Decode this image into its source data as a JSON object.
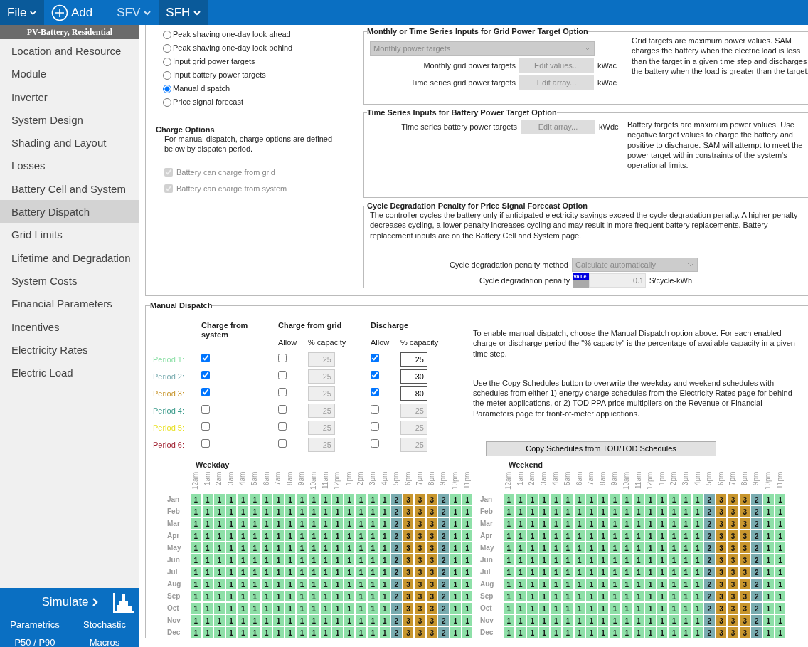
{
  "toolbar": [
    {
      "kind": "file",
      "label": "File"
    },
    {
      "kind": "add",
      "label": "Add"
    },
    {
      "kind": "case",
      "label": "SFV",
      "selected": false
    },
    {
      "kind": "case",
      "label": "SFH",
      "selected": true
    }
  ],
  "sidebar": {
    "title": "PV-Battery, Residential",
    "items": [
      {
        "label": "Location and Resource",
        "selected": false
      },
      {
        "label": "Module",
        "selected": false
      },
      {
        "label": "Inverter",
        "selected": false
      },
      {
        "label": "System Design",
        "selected": false
      },
      {
        "label": "Shading and Layout",
        "selected": false
      },
      {
        "label": "Losses",
        "selected": false
      },
      {
        "label": "Battery Cell and System",
        "selected": false
      },
      {
        "label": "Battery Dispatch",
        "selected": true
      },
      {
        "label": "Grid Limits",
        "selected": false
      },
      {
        "label": "Lifetime and Degradation",
        "selected": false
      },
      {
        "label": "System Costs",
        "selected": false
      },
      {
        "label": "Financial Parameters",
        "selected": false
      },
      {
        "label": "Incentives",
        "selected": false
      },
      {
        "label": "Electricity Rates",
        "selected": false
      },
      {
        "label": "Electric Load",
        "selected": false
      }
    ],
    "simulate": {
      "label": "Simulate",
      "links": [
        "Parametrics",
        "Stochastic",
        "P50 / P90",
        "Macros"
      ]
    }
  },
  "dispatch_options": [
    {
      "label": "Peak shaving one-day look ahead",
      "selected": false
    },
    {
      "label": "Peak shaving one-day look behind",
      "selected": false
    },
    {
      "label": "Input grid power targets",
      "selected": false
    },
    {
      "label": "Input battery power targets",
      "selected": false
    },
    {
      "label": "Manual dispatch",
      "selected": true
    },
    {
      "label": "Price signal forecast",
      "selected": false
    }
  ],
  "charge_options": {
    "title": "Charge Options",
    "note": "For manual dispatch, charge options are defined below by dispatch period.",
    "checkboxes": [
      {
        "label": "Battery can charge from grid",
        "checked": true,
        "disabled": true
      },
      {
        "label": "Battery can charge from system",
        "checked": true,
        "disabled": true
      }
    ]
  },
  "grid_target": {
    "title": "Monthly or Time Series Inputs for Grid Power Target Option",
    "dropdown": {
      "value": "Monthly power targets",
      "disabled": true
    },
    "rows": [
      {
        "label": "Monthly grid power targets",
        "button": "Edit values...",
        "unit": "kWac"
      },
      {
        "label": "Time series grid power targets",
        "button": "Edit array...",
        "unit": "kWac"
      }
    ],
    "note": "Grid targets are maximum power values. SAM charges the battery when the electric load is less than the target in a given time step and discharges the battery when the load is greater than the target."
  },
  "battery_target": {
    "title": "Time Series Inputs for Battery Power Target Option",
    "rows": [
      {
        "label": "Time series battery power targets",
        "button": "Edit array...",
        "unit": "kWdc"
      }
    ],
    "note": "Battery targets are maximum power values. Use negative target values to charge the battery and positive to discharge. SAM will attempt to meet the power target within constraints of the system's operational limits."
  },
  "cycle_penalty": {
    "title": "Cycle Degradation Penalty for Price Signal Forecast Option",
    "note": "The controller cycles the battery only if anticipated electricity savings exceed the cycle degradation penalty. A higher penalty decreases cycling, a lower penalty increases cycling and may result in more frequent battery replacements. Battery replacement inputs are on the  Battery Cell and System page.",
    "method_label": "Cycle degradation penalty method",
    "method_value": "Calculate automatically",
    "penalty_label": "Cycle degradation penalty",
    "penalty_badge": "Value",
    "penalty_value": "0.1",
    "penalty_unit": "$/cycle-kWh"
  },
  "manual_dispatch": {
    "title": "Manual Dispatch",
    "headers": {
      "charge_system": "Charge from system",
      "charge_grid": "Charge from grid",
      "discharge": "Discharge",
      "allow_1": "Allow",
      "capacity_1": "% capacity",
      "allow_2": "Allow",
      "capacity_2": "% capacity"
    },
    "periods": [
      {
        "label": "Period 1:",
        "color": "#8ee0a8",
        "charge_system": true,
        "grid_allow": false,
        "grid_capacity": "25",
        "discharge_allow": true,
        "discharge_capacity": "25"
      },
      {
        "label": "Period 2:",
        "color": "#7aacb0",
        "charge_system": true,
        "grid_allow": false,
        "grid_capacity": "25",
        "discharge_allow": true,
        "discharge_capacity": "30"
      },
      {
        "label": "Period 3:",
        "color": "#c8962e",
        "charge_system": true,
        "grid_allow": false,
        "grid_capacity": "25",
        "discharge_allow": true,
        "discharge_capacity": "80"
      },
      {
        "label": "Period 4:",
        "color": "#3a9a8a",
        "charge_system": false,
        "grid_allow": false,
        "grid_capacity": "25",
        "discharge_allow": false,
        "discharge_capacity": "25"
      },
      {
        "label": "Period 5:",
        "color": "#e8e020",
        "charge_system": false,
        "grid_allow": false,
        "grid_capacity": "25",
        "discharge_allow": false,
        "discharge_capacity": "25"
      },
      {
        "label": "Period 6:",
        "color": "#a02030",
        "charge_system": false,
        "grid_allow": false,
        "grid_capacity": "25",
        "discharge_allow": false,
        "discharge_capacity": "25"
      }
    ],
    "notes": [
      "To enable manual dispatch, choose the Manual Dispatch option above. For each enabled charge or discharge period the \"% capacity\" is the percentage of available capacity in a given time step.",
      "Use the Copy Schedules button to overwrite the weekday and weekend schedules with schedules from either 1) energy charge schedules from the Electricity Rates page for behind-the-meter applications, or 2) TOD PPA price multipliers on the Revenue or Financial Parameters page for front-of-meter applications."
    ],
    "copy_button": "Copy Schedules from TOU/TOD Schedules"
  },
  "schedules": [
    {
      "title": "Weekday",
      "hours": [
        "12am",
        "1am",
        "2am",
        "3am",
        "4am",
        "5am",
        "6am",
        "7am",
        "8am",
        "9am",
        "10am",
        "11am",
        "12pm",
        "1pm",
        "2pm",
        "3pm",
        "4pm",
        "5pm",
        "6pm",
        "7pm",
        "8pm",
        "9pm",
        "10pm",
        "11pm"
      ],
      "months": [
        "Jan",
        "Feb",
        "Mar",
        "Apr",
        "May",
        "Jun",
        "Jul",
        "Aug",
        "Sep",
        "Oct",
        "Nov",
        "Dec"
      ],
      "rows": [
        [
          "1",
          "1",
          "1",
          "1",
          "1",
          "1",
          "1",
          "1",
          "1",
          "1",
          "1",
          "1",
          "1",
          "1",
          "1",
          "1",
          "1",
          "2",
          "3",
          "3",
          "3",
          "2",
          "1",
          "1"
        ],
        [
          "1",
          "1",
          "1",
          "1",
          "1",
          "1",
          "1",
          "1",
          "1",
          "1",
          "1",
          "1",
          "1",
          "1",
          "1",
          "1",
          "1",
          "2",
          "3",
          "3",
          "3",
          "2",
          "1",
          "1"
        ],
        [
          "1",
          "1",
          "1",
          "1",
          "1",
          "1",
          "1",
          "1",
          "1",
          "1",
          "1",
          "1",
          "1",
          "1",
          "1",
          "1",
          "1",
          "2",
          "3",
          "3",
          "3",
          "2",
          "1",
          "1"
        ],
        [
          "1",
          "1",
          "1",
          "1",
          "1",
          "1",
          "1",
          "1",
          "1",
          "1",
          "1",
          "1",
          "1",
          "1",
          "1",
          "1",
          "1",
          "2",
          "3",
          "3",
          "3",
          "2",
          "1",
          "1"
        ],
        [
          "1",
          "1",
          "1",
          "1",
          "1",
          "1",
          "1",
          "1",
          "1",
          "1",
          "1",
          "1",
          "1",
          "1",
          "1",
          "1",
          "1",
          "2",
          "3",
          "3",
          "3",
          "2",
          "1",
          "1"
        ],
        [
          "1",
          "1",
          "1",
          "1",
          "1",
          "1",
          "1",
          "1",
          "1",
          "1",
          "1",
          "1",
          "1",
          "1",
          "1",
          "1",
          "1",
          "2",
          "3",
          "3",
          "3",
          "2",
          "1",
          "1"
        ],
        [
          "1",
          "1",
          "1",
          "1",
          "1",
          "1",
          "1",
          "1",
          "1",
          "1",
          "1",
          "1",
          "1",
          "1",
          "1",
          "1",
          "1",
          "2",
          "3",
          "3",
          "3",
          "2",
          "1",
          "1"
        ],
        [
          "1",
          "1",
          "1",
          "1",
          "1",
          "1",
          "1",
          "1",
          "1",
          "1",
          "1",
          "1",
          "1",
          "1",
          "1",
          "1",
          "1",
          "2",
          "3",
          "3",
          "3",
          "2",
          "1",
          "1"
        ],
        [
          "1",
          "1",
          "1",
          "1",
          "1",
          "1",
          "1",
          "1",
          "1",
          "1",
          "1",
          "1",
          "1",
          "1",
          "1",
          "1",
          "1",
          "2",
          "3",
          "3",
          "3",
          "2",
          "1",
          "1"
        ],
        [
          "1",
          "1",
          "1",
          "1",
          "1",
          "1",
          "1",
          "1",
          "1",
          "1",
          "1",
          "1",
          "1",
          "1",
          "1",
          "1",
          "1",
          "2",
          "3",
          "3",
          "3",
          "2",
          "1",
          "1"
        ],
        [
          "1",
          "1",
          "1",
          "1",
          "1",
          "1",
          "1",
          "1",
          "1",
          "1",
          "1",
          "1",
          "1",
          "1",
          "1",
          "1",
          "1",
          "2",
          "3",
          "3",
          "3",
          "2",
          "1",
          "1"
        ],
        [
          "1",
          "1",
          "1",
          "1",
          "1",
          "1",
          "1",
          "1",
          "1",
          "1",
          "1",
          "1",
          "1",
          "1",
          "1",
          "1",
          "1",
          "2",
          "3",
          "3",
          "3",
          "2",
          "1",
          "1"
        ]
      ]
    },
    {
      "title": "Weekend",
      "hours": [
        "12am",
        "1am",
        "2am",
        "3am",
        "4am",
        "5am",
        "6am",
        "7am",
        "8am",
        "9am",
        "10am",
        "11am",
        "12pm",
        "1pm",
        "2pm",
        "3pm",
        "4pm",
        "5pm",
        "6pm",
        "7pm",
        "8pm",
        "9pm",
        "10pm",
        "11pm"
      ],
      "months": [
        "Jan",
        "Feb",
        "Mar",
        "Apr",
        "May",
        "Jun",
        "Jul",
        "Aug",
        "Sep",
        "Oct",
        "Nov",
        "Dec"
      ],
      "rows": [
        [
          "1",
          "1",
          "1",
          "1",
          "1",
          "1",
          "1",
          "1",
          "1",
          "1",
          "1",
          "1",
          "1",
          "1",
          "1",
          "1",
          "1",
          "2",
          "3",
          "3",
          "3",
          "2",
          "1",
          "1"
        ],
        [
          "1",
          "1",
          "1",
          "1",
          "1",
          "1",
          "1",
          "1",
          "1",
          "1",
          "1",
          "1",
          "1",
          "1",
          "1",
          "1",
          "1",
          "2",
          "3",
          "3",
          "3",
          "2",
          "1",
          "1"
        ],
        [
          "1",
          "1",
          "1",
          "1",
          "1",
          "1",
          "1",
          "1",
          "1",
          "1",
          "1",
          "1",
          "1",
          "1",
          "1",
          "1",
          "1",
          "2",
          "3",
          "3",
          "3",
          "2",
          "1",
          "1"
        ],
        [
          "1",
          "1",
          "1",
          "1",
          "1",
          "1",
          "1",
          "1",
          "1",
          "1",
          "1",
          "1",
          "1",
          "1",
          "1",
          "1",
          "1",
          "2",
          "3",
          "3",
          "3",
          "2",
          "1",
          "1"
        ],
        [
          "1",
          "1",
          "1",
          "1",
          "1",
          "1",
          "1",
          "1",
          "1",
          "1",
          "1",
          "1",
          "1",
          "1",
          "1",
          "1",
          "1",
          "2",
          "3",
          "3",
          "3",
          "2",
          "1",
          "1"
        ],
        [
          "1",
          "1",
          "1",
          "1",
          "1",
          "1",
          "1",
          "1",
          "1",
          "1",
          "1",
          "1",
          "1",
          "1",
          "1",
          "1",
          "1",
          "2",
          "3",
          "3",
          "3",
          "2",
          "1",
          "1"
        ],
        [
          "1",
          "1",
          "1",
          "1",
          "1",
          "1",
          "1",
          "1",
          "1",
          "1",
          "1",
          "1",
          "1",
          "1",
          "1",
          "1",
          "1",
          "2",
          "3",
          "3",
          "3",
          "2",
          "1",
          "1"
        ],
        [
          "1",
          "1",
          "1",
          "1",
          "1",
          "1",
          "1",
          "1",
          "1",
          "1",
          "1",
          "1",
          "1",
          "1",
          "1",
          "1",
          "1",
          "2",
          "3",
          "3",
          "3",
          "2",
          "1",
          "1"
        ],
        [
          "1",
          "1",
          "1",
          "1",
          "1",
          "1",
          "1",
          "1",
          "1",
          "1",
          "1",
          "1",
          "1",
          "1",
          "1",
          "1",
          "1",
          "2",
          "3",
          "3",
          "3",
          "2",
          "1",
          "1"
        ],
        [
          "1",
          "1",
          "1",
          "1",
          "1",
          "1",
          "1",
          "1",
          "1",
          "1",
          "1",
          "1",
          "1",
          "1",
          "1",
          "1",
          "1",
          "2",
          "3",
          "3",
          "3",
          "2",
          "1",
          "1"
        ],
        [
          "1",
          "1",
          "1",
          "1",
          "1",
          "1",
          "1",
          "1",
          "1",
          "1",
          "1",
          "1",
          "1",
          "1",
          "1",
          "1",
          "1",
          "2",
          "3",
          "3",
          "3",
          "2",
          "1",
          "1"
        ],
        [
          "1",
          "1",
          "1",
          "1",
          "1",
          "1",
          "1",
          "1",
          "1",
          "1",
          "1",
          "1",
          "1",
          "1",
          "1",
          "1",
          "1",
          "2",
          "3",
          "3",
          "3",
          "2",
          "1",
          "1"
        ]
      ]
    }
  ]
}
